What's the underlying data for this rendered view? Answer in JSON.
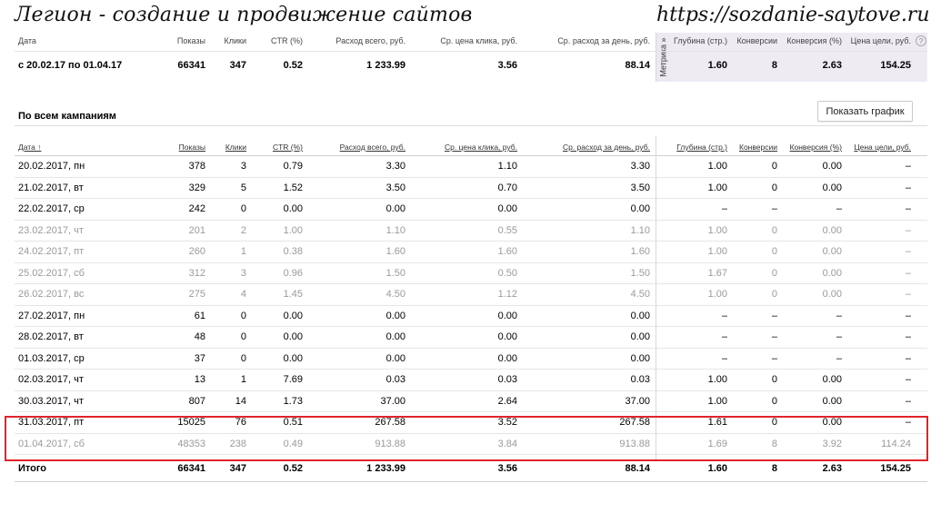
{
  "watermark": {
    "left": "Легион - создание и продвижение сайтов",
    "right": "https://sozdanie-saytove.ru"
  },
  "colors": {
    "highlight": "#e0232b",
    "metrika_band": "#eeebf3"
  },
  "metrika_tab_label": "Метрика »",
  "columns": [
    "Дата",
    "Показы",
    "Клики",
    "CTR (%)",
    "Расход всего, руб.",
    "Ср. цена клика, руб.",
    "Ср. расход за день, руб.",
    "Глубина (стр.)",
    "Конверсии",
    "Конверсия (%)",
    "Цена цели, руб."
  ],
  "table_columns": [
    "Дата ↑",
    "Показы",
    "Клики",
    "CTR (%)",
    "Расход всего, руб.",
    "Ср. цена клика, руб.",
    "Ср. расход за день, руб.",
    "Глубина (стр.)",
    "Конверсии",
    "Конверсия (%)",
    "Цена цели, руб."
  ],
  "summary_row": [
    "с 20.02.17 по 01.04.17",
    "66341",
    "347",
    "0.52",
    "1 233.99",
    "3.56",
    "88.14",
    "1.60",
    "8",
    "2.63",
    "154.25"
  ],
  "section_title": "По всем кампаниям",
  "show_chart_button": "Показать график",
  "help_icon": "question-circle-icon",
  "rows": [
    {
      "muted": false,
      "cells": [
        "20.02.2017, пн",
        "378",
        "3",
        "0.79",
        "3.30",
        "1.10",
        "3.30",
        "1.00",
        "0",
        "0.00",
        "–"
      ]
    },
    {
      "muted": false,
      "cells": [
        "21.02.2017, вт",
        "329",
        "5",
        "1.52",
        "3.50",
        "0.70",
        "3.50",
        "1.00",
        "0",
        "0.00",
        "–"
      ]
    },
    {
      "muted": false,
      "cells": [
        "22.02.2017, ср",
        "242",
        "0",
        "0.00",
        "0.00",
        "0.00",
        "0.00",
        "–",
        "–",
        "–",
        "–"
      ]
    },
    {
      "muted": true,
      "cells": [
        "23.02.2017, чт",
        "201",
        "2",
        "1.00",
        "1.10",
        "0.55",
        "1.10",
        "1.00",
        "0",
        "0.00",
        "–"
      ]
    },
    {
      "muted": true,
      "cells": [
        "24.02.2017, пт",
        "260",
        "1",
        "0.38",
        "1.60",
        "1.60",
        "1.60",
        "1.00",
        "0",
        "0.00",
        "–"
      ]
    },
    {
      "muted": true,
      "cells": [
        "25.02.2017, сб",
        "312",
        "3",
        "0.96",
        "1.50",
        "0.50",
        "1.50",
        "1.67",
        "0",
        "0.00",
        "–"
      ]
    },
    {
      "muted": true,
      "cells": [
        "26.02.2017, вс",
        "275",
        "4",
        "1.45",
        "4.50",
        "1.12",
        "4.50",
        "1.00",
        "0",
        "0.00",
        "–"
      ]
    },
    {
      "muted": false,
      "cells": [
        "27.02.2017, пн",
        "61",
        "0",
        "0.00",
        "0.00",
        "0.00",
        "0.00",
        "–",
        "–",
        "–",
        "–"
      ]
    },
    {
      "muted": false,
      "cells": [
        "28.02.2017, вт",
        "48",
        "0",
        "0.00",
        "0.00",
        "0.00",
        "0.00",
        "–",
        "–",
        "–",
        "–"
      ]
    },
    {
      "muted": false,
      "cells": [
        "01.03.2017, ср",
        "37",
        "0",
        "0.00",
        "0.00",
        "0.00",
        "0.00",
        "–",
        "–",
        "–",
        "–"
      ]
    },
    {
      "muted": false,
      "cells": [
        "02.03.2017, чт",
        "13",
        "1",
        "7.69",
        "0.03",
        "0.03",
        "0.03",
        "1.00",
        "0",
        "0.00",
        "–"
      ]
    },
    {
      "muted": false,
      "cells": [
        "30.03.2017, чт",
        "807",
        "14",
        "1.73",
        "37.00",
        "2.64",
        "37.00",
        "1.00",
        "0",
        "0.00",
        "–"
      ]
    },
    {
      "muted": false,
      "cells": [
        "31.03.2017, пт",
        "15025",
        "76",
        "0.51",
        "267.58",
        "3.52",
        "267.58",
        "1.61",
        "0",
        "0.00",
        "–"
      ]
    },
    {
      "muted": true,
      "cells": [
        "01.04.2017, сб",
        "48353",
        "238",
        "0.49",
        "913.88",
        "3.84",
        "913.88",
        "1.69",
        "8",
        "3.92",
        "114.24"
      ]
    }
  ],
  "total_row": [
    "Итого",
    "66341",
    "347",
    "0.52",
    "1 233.99",
    "3.56",
    "88.14",
    "1.60",
    "8",
    "2.63",
    "154.25"
  ]
}
